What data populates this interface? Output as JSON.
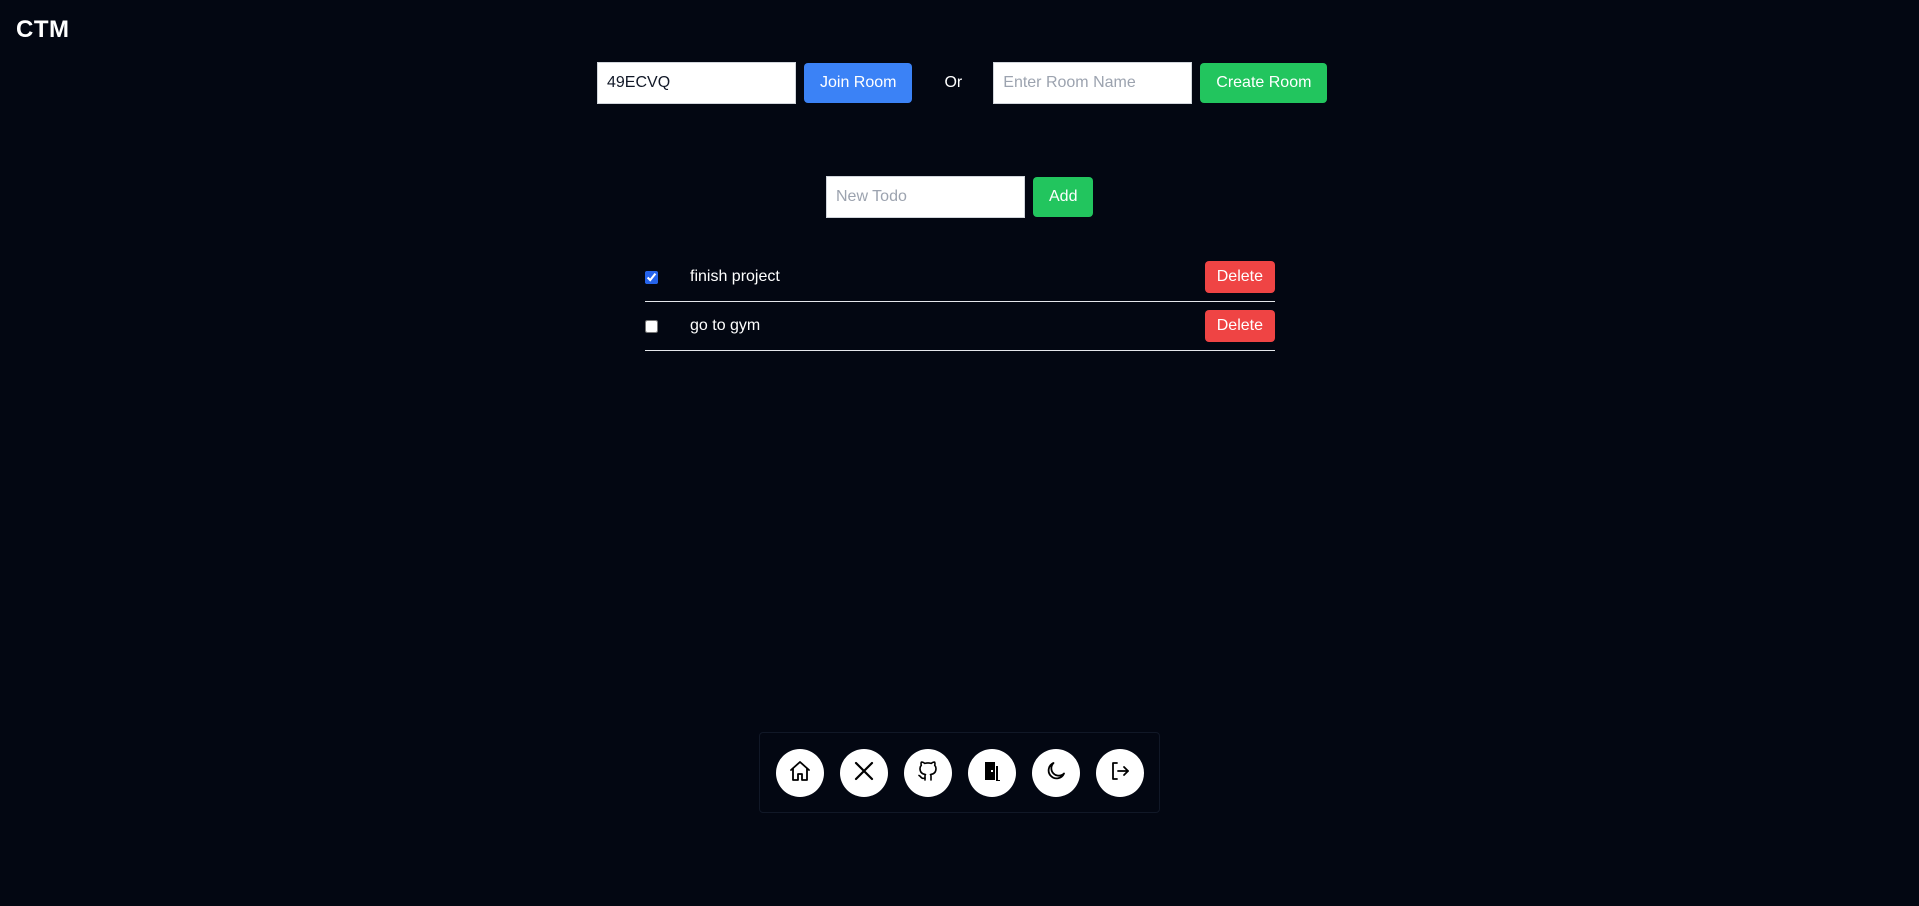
{
  "app": {
    "title": "CTM"
  },
  "room": {
    "join_code_value": "49ECVQ",
    "join_label": "Join Room",
    "or_label": "Or",
    "name_placeholder": "Enter Room Name",
    "create_label": "Create Room"
  },
  "todo_form": {
    "placeholder": "New Todo",
    "add_label": "Add"
  },
  "todos": [
    {
      "text": "finish project",
      "done": true,
      "delete_label": "Delete"
    },
    {
      "text": "go to gym",
      "done": false,
      "delete_label": "Delete"
    }
  ],
  "dock": {
    "items": [
      {
        "icon": "home-icon"
      },
      {
        "icon": "x-icon"
      },
      {
        "icon": "github-icon"
      },
      {
        "icon": "door-icon"
      },
      {
        "icon": "moon-icon"
      },
      {
        "icon": "logout-icon"
      }
    ]
  },
  "colors": {
    "background": "#030712",
    "join_button": "#3b82f6",
    "create_button": "#22c55e",
    "delete_button": "#ef4444",
    "checkbox": "#2563eb"
  }
}
